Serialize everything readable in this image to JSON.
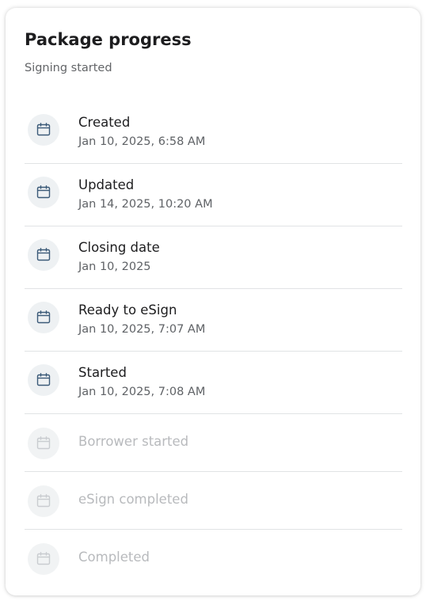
{
  "card": {
    "title": "Package progress",
    "subtitle": "Signing started"
  },
  "milestones": [
    {
      "label": "Created",
      "time": "Jan 10, 2025, 6:58 AM",
      "state": "done",
      "icon": "calendar-icon"
    },
    {
      "label": "Updated",
      "time": "Jan 14, 2025, 10:20 AM",
      "state": "done",
      "icon": "calendar-icon"
    },
    {
      "label": "Closing date",
      "time": "Jan 10, 2025",
      "state": "done",
      "icon": "calendar-icon"
    },
    {
      "label": "Ready to eSign",
      "time": "Jan 10, 2025, 7:07 AM",
      "state": "done",
      "icon": "calendar-icon"
    },
    {
      "label": "Started",
      "time": "Jan 10, 2025, 7:08 AM",
      "state": "done",
      "icon": "calendar-icon"
    },
    {
      "label": "Borrower started",
      "state": "pending",
      "icon": "calendar-icon"
    },
    {
      "label": "eSign completed",
      "state": "pending",
      "icon": "calendar-icon"
    },
    {
      "label": "Completed",
      "state": "pending",
      "icon": "calendar-icon"
    }
  ],
  "colors": {
    "done_icon": "#3b5a78",
    "pending_icon": "#c9ccd0",
    "icon_background": "#eef1f3",
    "divider": "#e1e3e5"
  }
}
